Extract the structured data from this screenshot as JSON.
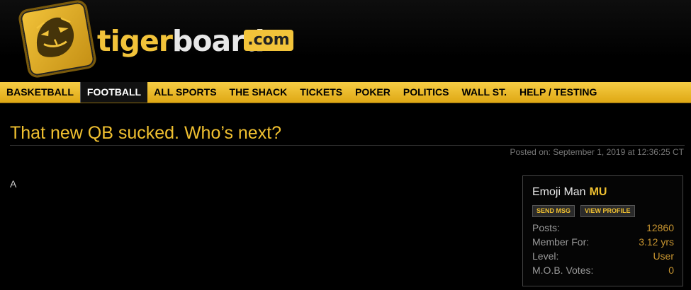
{
  "logo": {
    "text_tiger": "tiger",
    "text_board": "board",
    "text_com": ".com"
  },
  "nav": {
    "items": [
      {
        "label": "BASKETBALL",
        "active": false
      },
      {
        "label": "FOOTBALL",
        "active": true
      },
      {
        "label": "ALL SPORTS",
        "active": false
      },
      {
        "label": "THE SHACK",
        "active": false
      },
      {
        "label": "TICKETS",
        "active": false
      },
      {
        "label": "POKER",
        "active": false
      },
      {
        "label": "POLITICS",
        "active": false
      },
      {
        "label": "WALL ST.",
        "active": false
      },
      {
        "label": "HELP / TESTING",
        "active": false
      }
    ]
  },
  "post": {
    "title": "That new QB sucked. Who’s next?",
    "posted_on": "Posted on: September 1, 2019 at 12:36:25 CT",
    "body": "A"
  },
  "user": {
    "name": "Emoji Man",
    "school": "MU",
    "send_msg_label": "SEND MSG",
    "view_profile_label": "VIEW PROFILE",
    "stats": [
      {
        "label": "Posts:",
        "value": "12860"
      },
      {
        "label": "Member For:",
        "value": "3.12 yrs"
      },
      {
        "label": "Level:",
        "value": "User"
      },
      {
        "label": "M.O.B. Votes:",
        "value": "0"
      }
    ]
  },
  "colors": {
    "accent": "#f0c030",
    "nav_bg": "#f6cd45",
    "background": "#000000"
  },
  "icons": {
    "logo": "tiger-head-icon"
  }
}
